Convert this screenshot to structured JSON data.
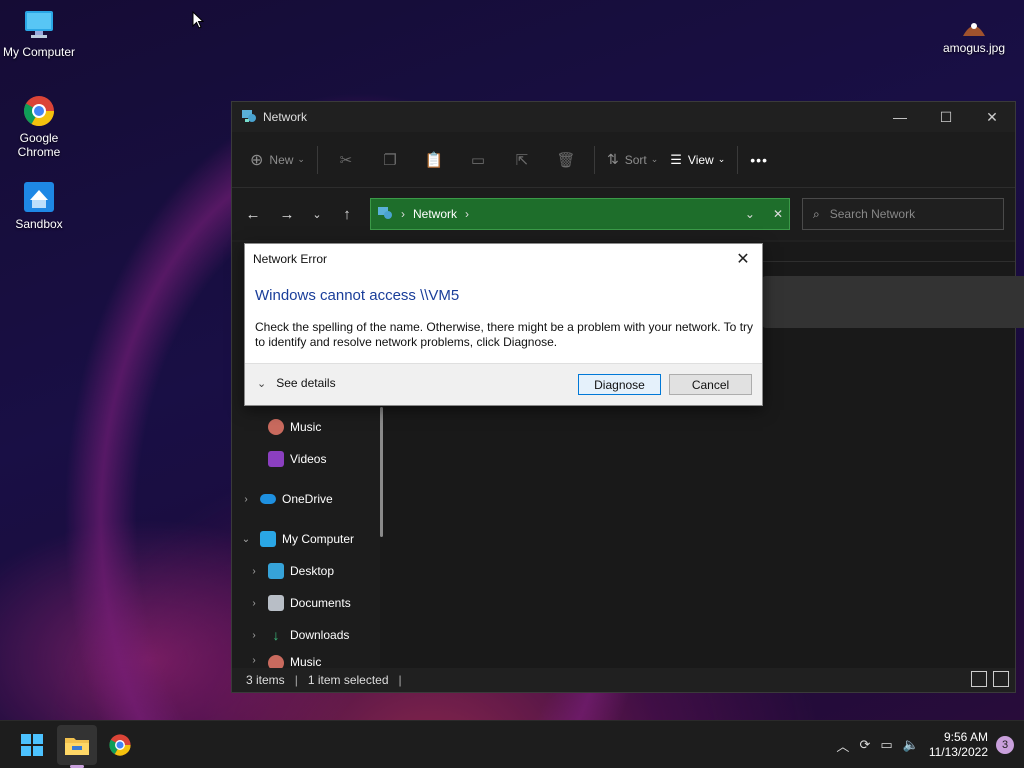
{
  "desktop": {
    "icons": [
      {
        "label": "My Computer",
        "icon": "monitor-icon"
      },
      {
        "label": "Google Chrome",
        "icon": "chrome-icon"
      },
      {
        "label": "Sandbox",
        "icon": "sandbox-icon"
      },
      {
        "label": "amogus.jpg",
        "icon": "image-file-icon"
      }
    ]
  },
  "window": {
    "title": "Network",
    "controls": {
      "minimize": "—",
      "maximize": "☐",
      "close": "✕"
    },
    "toolbar": {
      "new_label": "New",
      "sort_label": "Sort",
      "view_label": "View",
      "more_label": "•••"
    },
    "address": {
      "segment": "Network"
    },
    "search_placeholder": "Search Network",
    "nav_items": [
      {
        "label": "Music",
        "indent": 2
      },
      {
        "label": "Videos",
        "indent": 2
      },
      {
        "label": "OneDrive",
        "indent": 1
      },
      {
        "label": "My Computer",
        "indent": 1
      },
      {
        "label": "Desktop",
        "indent": 2
      },
      {
        "label": "Documents",
        "indent": 2
      },
      {
        "label": "Downloads",
        "indent": 2
      },
      {
        "label": "Music",
        "indent": 2
      }
    ],
    "status": {
      "items": "3 items",
      "selected": "1 item selected"
    }
  },
  "dialog": {
    "title": "Network Error",
    "heading": "Windows cannot access \\\\VM5",
    "body": "Check the spelling of the name. Otherwise, there might be a problem with your network. To try to identify and resolve network problems, click Diagnose.",
    "see_details": "See details",
    "diagnose": "Diagnose",
    "cancel": "Cancel"
  },
  "taskbar": {
    "time": "9:56 AM",
    "date": "11/13/2022",
    "notification_count": "3"
  }
}
